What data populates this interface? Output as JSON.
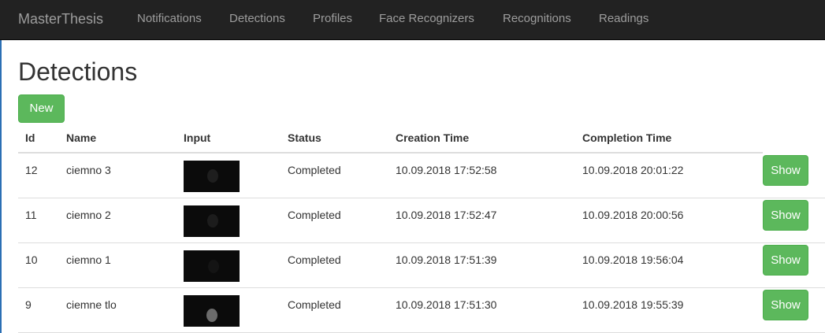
{
  "navbar": {
    "brand": "MasterThesis",
    "links": [
      "Notifications",
      "Detections",
      "Profiles",
      "Face Recognizers",
      "Recognitions",
      "Readings"
    ]
  },
  "page": {
    "title": "Detections"
  },
  "new_button": "New",
  "table": {
    "columns": [
      "Id",
      "Name",
      "Input",
      "Status",
      "Creation Time",
      "Completion Time"
    ],
    "rows": [
      {
        "id": "12",
        "name": "ciemno 3",
        "status": "Completed",
        "creation_time": "10.09.2018 17:52:58",
        "completion_time": "10.09.2018 20:01:22",
        "action": "Show"
      },
      {
        "id": "11",
        "name": "ciemno 2",
        "status": "Completed",
        "creation_time": "10.09.2018 17:52:47",
        "completion_time": "10.09.2018 20:00:56",
        "action": "Show"
      },
      {
        "id": "10",
        "name": "ciemno 1",
        "status": "Completed",
        "creation_time": "10.09.2018 17:51:39",
        "completion_time": "10.09.2018 19:56:04",
        "action": "Show"
      },
      {
        "id": "9",
        "name": "ciemne tlo",
        "status": "Completed",
        "creation_time": "10.09.2018 17:51:30",
        "completion_time": "10.09.2018 19:55:39",
        "action": "Show"
      }
    ]
  },
  "colors": {
    "navbar": "#222222",
    "nav_text": "#9d9d9d",
    "success": "#5cb85c",
    "thumbnail": "#0b0b0b"
  }
}
